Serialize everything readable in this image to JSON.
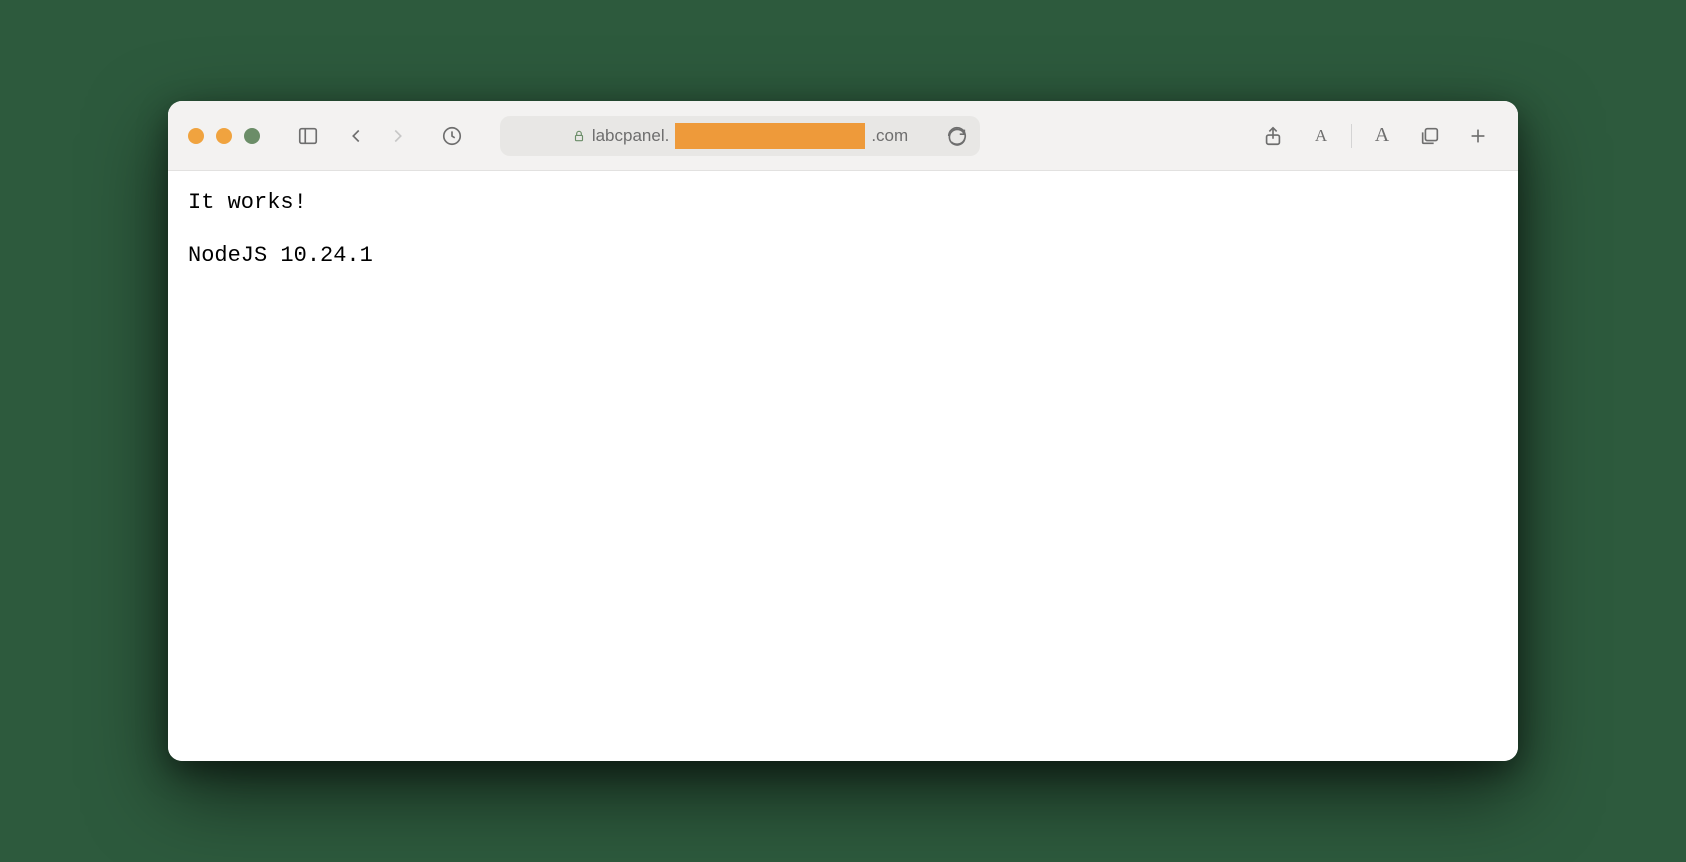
{
  "toolbar": {
    "address": {
      "prefix": "labcpanel.",
      "suffix": ".com"
    },
    "font_small": "A",
    "font_large": "A"
  },
  "page": {
    "line1": "It works!",
    "line2": "NodeJS 10.24.1"
  }
}
